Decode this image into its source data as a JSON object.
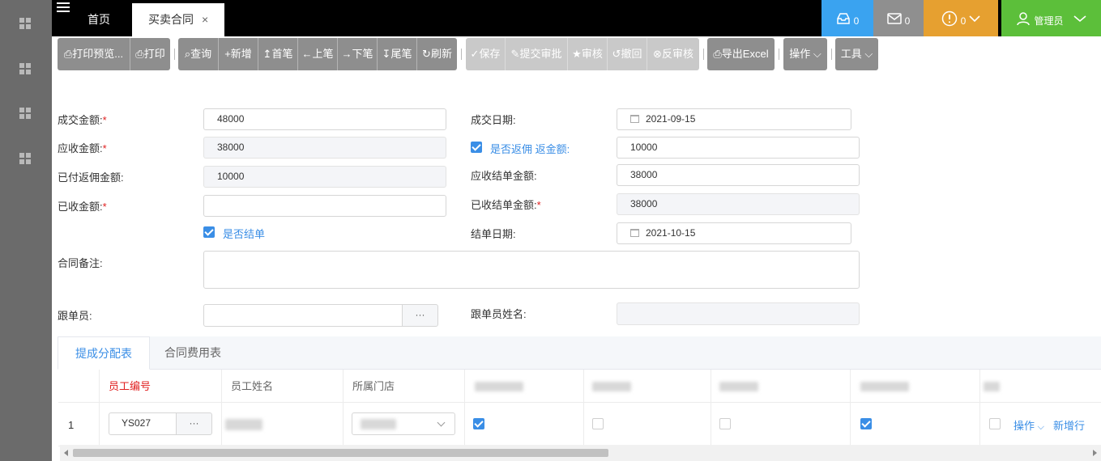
{
  "nav": {
    "home_tab": "首页",
    "active_tab": "买卖合同",
    "close": "×"
  },
  "header": {
    "inbox_count": "0",
    "mail_count": "0",
    "alert_count": "0",
    "user": "管理员"
  },
  "toolbar": {
    "print_preview": "打印预览...",
    "print": "打印",
    "query": "查询",
    "add": "新增",
    "first": "首笔",
    "prev": "上笔",
    "next": "下笔",
    "last": "尾笔",
    "refresh": "刷新",
    "save": "保存",
    "submit": "提交审批",
    "approve": "审核",
    "withdraw": "撤回",
    "unapprove": "反审核",
    "export": "导出Excel",
    "operate": "操作",
    "tools": "工具"
  },
  "form": {
    "deal_amount_label": "成交金额:",
    "deal_amount": "48000",
    "deal_date_label": "成交日期:",
    "deal_date": "2021-09-15",
    "receivable_label": "应收金额:",
    "receivable": "38000",
    "rebate_check_label": "是否返佣 返金额:",
    "rebate_amount": "10000",
    "paid_rebate_label": "已付返佣金额:",
    "paid_rebate": "10000",
    "settle_receivable_label": "应收结单金额:",
    "settle_receivable": "38000",
    "received_label": "已收金额:",
    "received": "",
    "settled_received_label": "已收结单金额:",
    "settled_received": "38000",
    "is_settled_label": "是否结单",
    "settle_date_label": "结单日期:",
    "settle_date": "2021-10-15",
    "remark_label": "合同备注:",
    "follower_label": "跟单员:",
    "follower_name_label": "跟单员姓名:",
    "dots": "···",
    "required_mark": "*"
  },
  "tabs": {
    "tab1": "提成分配表",
    "tab2": "合同费用表"
  },
  "grid": {
    "headers": [
      "员工编号",
      "员工姓名",
      "所属门店"
    ],
    "row": {
      "index": "1",
      "emp_code": "YS027",
      "dots": "···",
      "operate": "操作",
      "add_row": "新增行"
    }
  },
  "icons": {
    "menu": "hamburger-icon",
    "inbox": "inbox-icon",
    "mail": "mail-icon",
    "alert": "alert-circle-icon",
    "user": "user-icon"
  },
  "colors": {
    "primary": "#3a8ee6",
    "toolbar": "#8e8e8e",
    "inbox": "#3aa3f0",
    "warn": "#e6a030",
    "user": "#5cbf3a",
    "required": "#e02020"
  }
}
